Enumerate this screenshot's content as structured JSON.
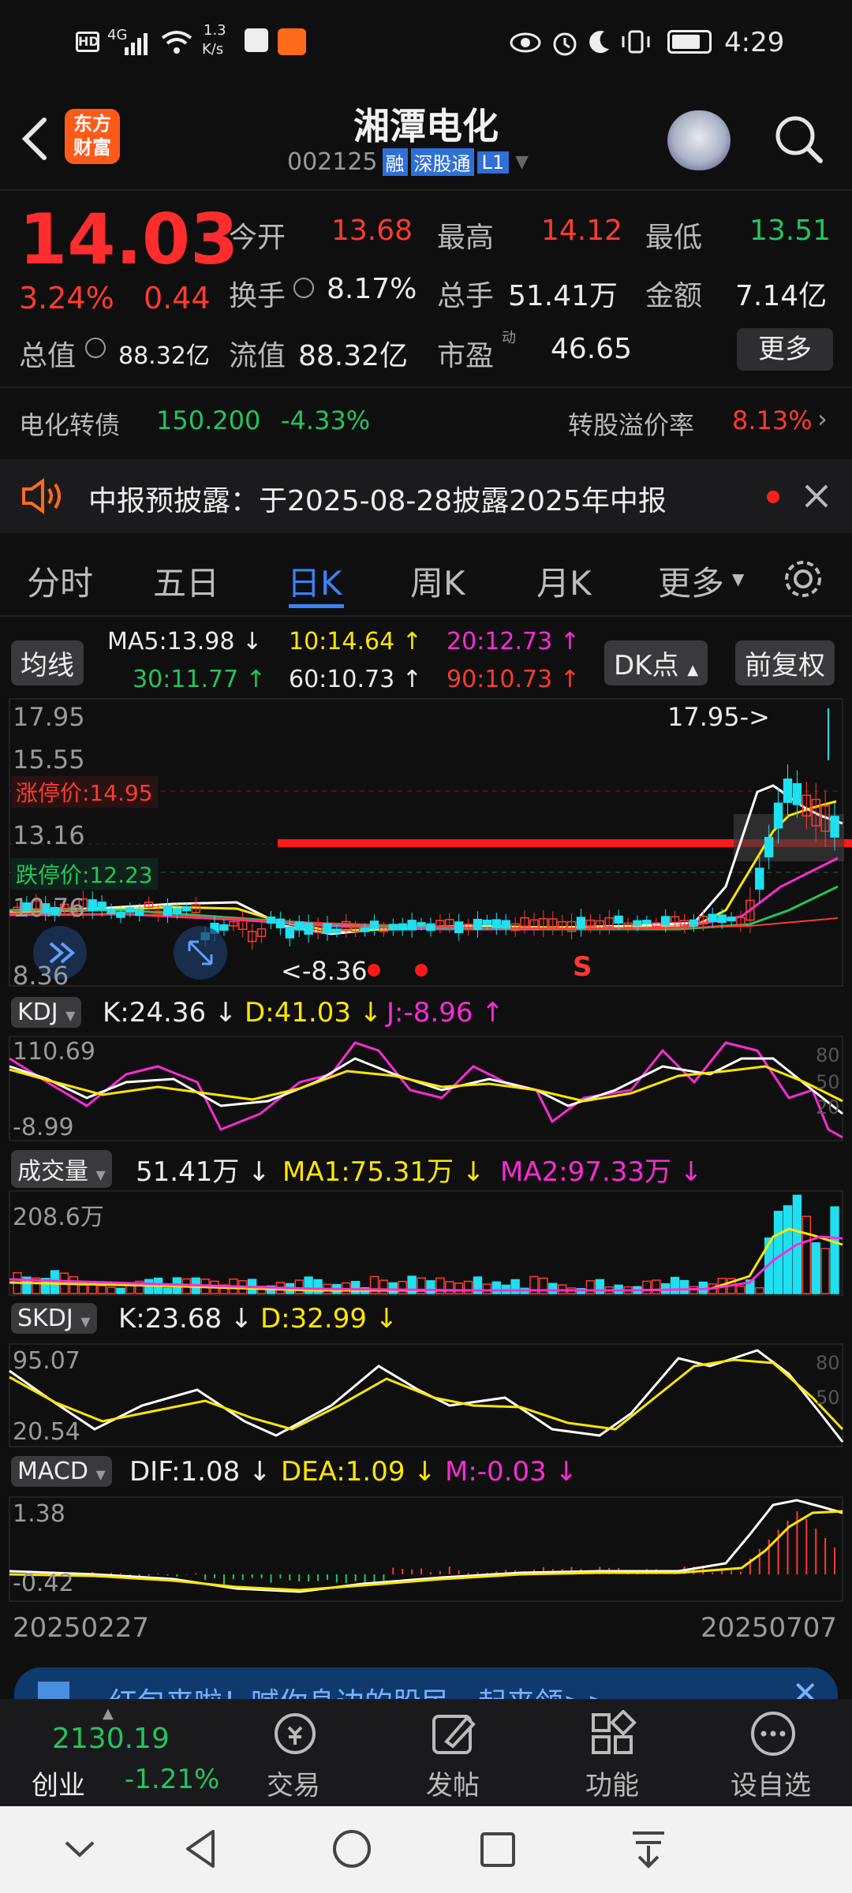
{
  "status_bar": {
    "network": "4G",
    "speed": "1.3",
    "speed_unit": "K/s",
    "time": "4:29",
    "battery": "battery-icon"
  },
  "header": {
    "logo_line1": "东方",
    "logo_line2": "财富",
    "title": "湘潭电化",
    "code": "002125",
    "badge_rong": "融",
    "badge_sgt": "深股通",
    "badge_l1": "L1"
  },
  "quote": {
    "price": "14.03",
    "pct": "3.24%",
    "chg": "0.44",
    "open_label": "今开",
    "open": "13.68",
    "high_label": "最高",
    "high": "14.12",
    "low_label": "最低",
    "low": "13.51",
    "turnover_label": "换手",
    "turnover": "8.17%",
    "vol_label": "总手",
    "vol": "51.41万",
    "amount_label": "金额",
    "amount": "7.14亿",
    "mcap_label": "总值",
    "mcap": "88.32亿",
    "float_label": "流值",
    "float": "88.32亿",
    "pe_label": "市盈",
    "pe_sup": "动",
    "pe": "46.65",
    "more": "更多"
  },
  "bond": {
    "name": "电化转债",
    "price": "150.200",
    "pct": "-4.33%",
    "premium_label": "转股溢价率",
    "premium": "8.13%"
  },
  "notice": {
    "text": "中报预披露：于2025-08-28披露2025年中报"
  },
  "tabs": [
    "分时",
    "五日",
    "日K",
    "周K",
    "月K",
    "更多"
  ],
  "ma": {
    "label": "均线",
    "ma5": "MA5:13.98",
    "ma10": "10:14.64",
    "ma20": "20:12.73",
    "ma30": "30:11.77",
    "ma60": "60:10.73",
    "ma90": "90:10.73",
    "dk": "DK点",
    "fq": "前复权"
  },
  "kline": {
    "y_top": "17.95",
    "y2": "15.55",
    "limit_up": "涨停价:14.95",
    "y3": "13.16",
    "limit_down": "跌停价:12.23",
    "y4": "10.76",
    "y_low": "8.36",
    "high_tag": "17.95->",
    "low_tag": "<-8.36",
    "s_mark": "S"
  },
  "kdj": {
    "name": "KDJ",
    "k": "K:24.36",
    "d": "D:41.03",
    "j": "J:-8.96",
    "top": "110.69",
    "bottom": "-8.99",
    "r80": "80",
    "r50": "50",
    "r20": "20"
  },
  "volume": {
    "name": "成交量",
    "v": "51.41万",
    "ma1": "MA1:75.31万",
    "ma2": "MA2:97.33万",
    "top": "208.6万"
  },
  "skdj": {
    "name": "SKDJ",
    "k": "K:23.68",
    "d": "D:32.99",
    "top": "95.07",
    "bottom": "20.54",
    "r80": "80",
    "r50": "50"
  },
  "macd": {
    "name": "MACD",
    "dif": "DIF:1.08",
    "dea": "DEA:1.09",
    "m": "M:-0.03",
    "top": "1.38",
    "bottom": "-0.42"
  },
  "dates": {
    "start": "20250227",
    "end": "20250707"
  },
  "banner": {
    "text": "红包来啦！喊你身边的股民一起来领>>"
  },
  "bottom": {
    "index_value": "2130.19",
    "index_name": "创业",
    "index_pct": "-1.21%",
    "trade": "交易",
    "post": "发帖",
    "func": "功能",
    "watch": "设自选"
  },
  "colors": {
    "bg": "#0f0f10",
    "up": "#ff3b30",
    "down": "#22c55e",
    "ma5": "#ffffff",
    "ma10": "#ffe600",
    "ma20": "#ff2bd6",
    "ma30": "#22c55e"
  }
}
